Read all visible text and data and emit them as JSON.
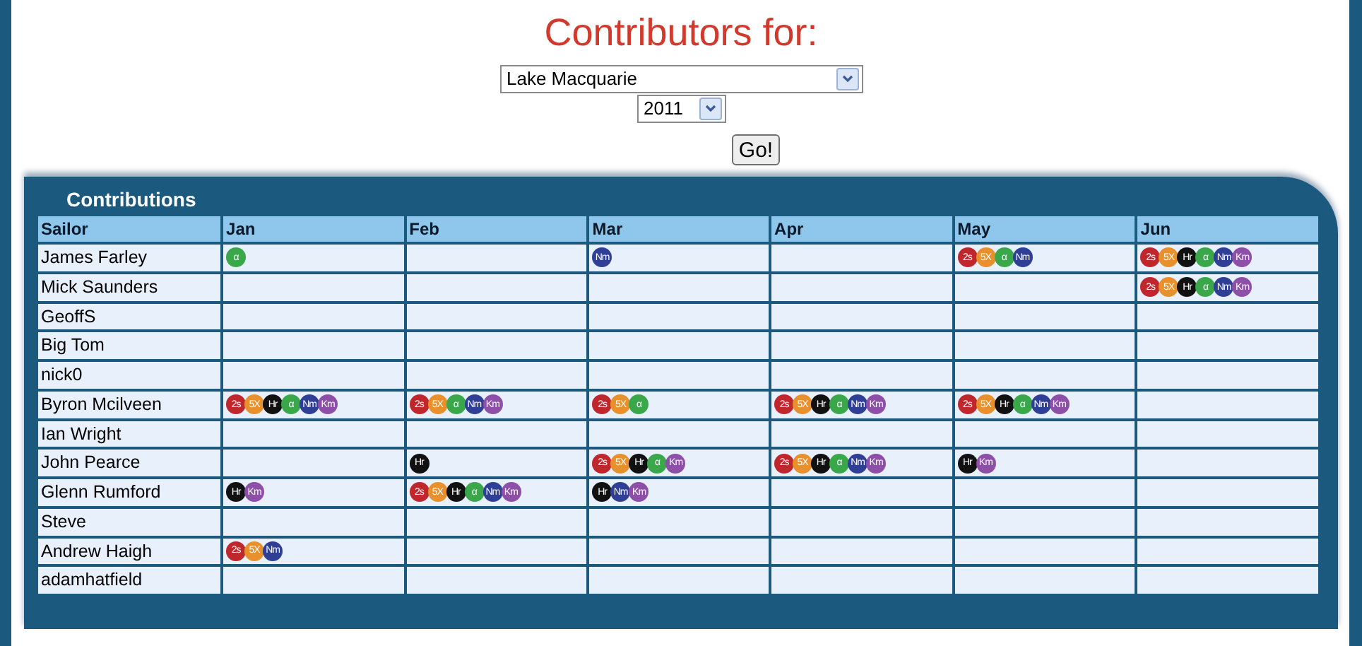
{
  "title": "Contributors for:",
  "location_select": {
    "value": "Lake Macquarie"
  },
  "year_select": {
    "value": "2011"
  },
  "go_button": "Go!",
  "panel": {
    "title": "Contributions",
    "columns": [
      "Sailor",
      "Jan",
      "Feb",
      "Mar",
      "Apr",
      "May",
      "Jun"
    ],
    "rows": [
      {
        "sailor": "James Farley",
        "jan": [
          {
            "label": "α",
            "color": "#3aa84a"
          }
        ],
        "mar": [
          {
            "label": "Nm",
            "color": "#2f3f95"
          }
        ],
        "may": [
          {
            "label": "2s",
            "color": "#c0272d"
          },
          {
            "label": "5X",
            "color": "#e8912c"
          },
          {
            "label": "α",
            "color": "#3aa84a"
          },
          {
            "label": "Nm",
            "color": "#2f3f95"
          }
        ],
        "jun": [
          {
            "label": "2s",
            "color": "#c0272d"
          },
          {
            "label": "5X",
            "color": "#e8912c"
          },
          {
            "label": "Hr",
            "color": "#111111"
          },
          {
            "label": "α",
            "color": "#3aa84a"
          },
          {
            "label": "Nm",
            "color": "#2f3f95"
          },
          {
            "label": "Km",
            "color": "#8e4fa8"
          }
        ]
      },
      {
        "sailor": "Mick Saunders",
        "jun": [
          {
            "label": "2s",
            "color": "#c0272d"
          },
          {
            "label": "5X",
            "color": "#e8912c"
          },
          {
            "label": "Hr",
            "color": "#111111"
          },
          {
            "label": "α",
            "color": "#3aa84a"
          },
          {
            "label": "Nm",
            "color": "#2f3f95"
          },
          {
            "label": "Km",
            "color": "#8e4fa8"
          }
        ]
      },
      {
        "sailor": "GeoffS"
      },
      {
        "sailor": "Big Tom"
      },
      {
        "sailor": "nick0"
      },
      {
        "sailor": "Byron Mcilveen",
        "jan": [
          {
            "label": "2s",
            "color": "#c0272d"
          },
          {
            "label": "5X",
            "color": "#e8912c"
          },
          {
            "label": "Hr",
            "color": "#111111"
          },
          {
            "label": "α",
            "color": "#3aa84a"
          },
          {
            "label": "Nm",
            "color": "#2f3f95"
          },
          {
            "label": "Km",
            "color": "#8e4fa8"
          }
        ],
        "feb": [
          {
            "label": "2s",
            "color": "#c0272d"
          },
          {
            "label": "5X",
            "color": "#e8912c"
          },
          {
            "label": "α",
            "color": "#3aa84a"
          },
          {
            "label": "Nm",
            "color": "#2f3f95"
          },
          {
            "label": "Km",
            "color": "#8e4fa8"
          }
        ],
        "mar": [
          {
            "label": "2s",
            "color": "#c0272d"
          },
          {
            "label": "5X",
            "color": "#e8912c"
          },
          {
            "label": "α",
            "color": "#3aa84a"
          }
        ],
        "apr": [
          {
            "label": "2s",
            "color": "#c0272d"
          },
          {
            "label": "5X",
            "color": "#e8912c"
          },
          {
            "label": "Hr",
            "color": "#111111"
          },
          {
            "label": "α",
            "color": "#3aa84a"
          },
          {
            "label": "Nm",
            "color": "#2f3f95"
          },
          {
            "label": "Km",
            "color": "#8e4fa8"
          }
        ],
        "may": [
          {
            "label": "2s",
            "color": "#c0272d"
          },
          {
            "label": "5X",
            "color": "#e8912c"
          },
          {
            "label": "Hr",
            "color": "#111111"
          },
          {
            "label": "α",
            "color": "#3aa84a"
          },
          {
            "label": "Nm",
            "color": "#2f3f95"
          },
          {
            "label": "Km",
            "color": "#8e4fa8"
          }
        ]
      },
      {
        "sailor": "Ian Wright"
      },
      {
        "sailor": "John Pearce",
        "feb": [
          {
            "label": "Hr",
            "color": "#111111"
          }
        ],
        "mar": [
          {
            "label": "2s",
            "color": "#c0272d"
          },
          {
            "label": "5X",
            "color": "#e8912c"
          },
          {
            "label": "Hr",
            "color": "#111111"
          },
          {
            "label": "α",
            "color": "#3aa84a"
          },
          {
            "label": "Km",
            "color": "#8e4fa8"
          }
        ],
        "apr": [
          {
            "label": "2s",
            "color": "#c0272d"
          },
          {
            "label": "5X",
            "color": "#e8912c"
          },
          {
            "label": "Hr",
            "color": "#111111"
          },
          {
            "label": "α",
            "color": "#3aa84a"
          },
          {
            "label": "Nm",
            "color": "#2f3f95"
          },
          {
            "label": "Km",
            "color": "#8e4fa8"
          }
        ],
        "may": [
          {
            "label": "Hr",
            "color": "#111111"
          },
          {
            "label": "Km",
            "color": "#8e4fa8"
          }
        ]
      },
      {
        "sailor": "Glenn Rumford",
        "jan": [
          {
            "label": "Hr",
            "color": "#111111"
          },
          {
            "label": "Km",
            "color": "#8e4fa8"
          }
        ],
        "feb": [
          {
            "label": "2s",
            "color": "#c0272d"
          },
          {
            "label": "5X",
            "color": "#e8912c"
          },
          {
            "label": "Hr",
            "color": "#111111"
          },
          {
            "label": "α",
            "color": "#3aa84a"
          },
          {
            "label": "Nm",
            "color": "#2f3f95"
          },
          {
            "label": "Km",
            "color": "#8e4fa8"
          }
        ],
        "mar": [
          {
            "label": "Hr",
            "color": "#111111"
          },
          {
            "label": "Nm",
            "color": "#2f3f95"
          },
          {
            "label": "Km",
            "color": "#8e4fa8"
          }
        ]
      },
      {
        "sailor": "Steve"
      },
      {
        "sailor": "Andrew Haigh",
        "jan": [
          {
            "label": "2s",
            "color": "#c0272d"
          },
          {
            "label": "5X",
            "color": "#e8912c"
          },
          {
            "label": "Nm",
            "color": "#2f3f95"
          }
        ]
      },
      {
        "sailor": "adamhatfield"
      }
    ]
  }
}
